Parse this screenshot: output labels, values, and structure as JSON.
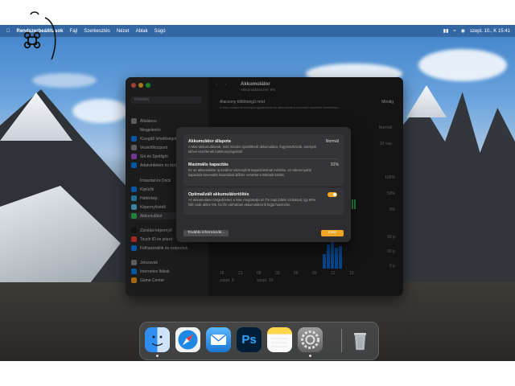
{
  "menubar": {
    "app_name": "Rendszerbeállítások",
    "menus": [
      "Fájl",
      "Szerkesztés",
      "Nézet",
      "Ablak",
      "Súgó"
    ],
    "clock": "szept. 10., K  15:41"
  },
  "settings_window": {
    "search_placeholder": "Keresés",
    "sidebar_items": [
      {
        "label": "Általános",
        "color": "#8e8e93"
      },
      {
        "label": "Megjelenés",
        "color": "#2c2c2e"
      },
      {
        "label": "Kisegítő lehetőségek",
        "color": "#0a84ff"
      },
      {
        "label": "Vezérlőközpont",
        "color": "#8e8e93"
      },
      {
        "label": "Siri és Spotlight",
        "color": "#af52de"
      },
      {
        "label": "Adatvédelem és biztonság",
        "color": "#0a84ff"
      },
      {
        "label": "Íróasztal és Dock",
        "color": "#2c2c2e"
      },
      {
        "label": "Kijelzők",
        "color": "#0a84ff"
      },
      {
        "label": "Háttérkép",
        "color": "#32ade6"
      },
      {
        "label": "Képernyővédő",
        "color": "#5ac8fa"
      },
      {
        "label": "Akkumulátor",
        "color": "#34c759"
      },
      {
        "label": "Zárolási képernyő",
        "color": "#1c1c1e"
      },
      {
        "label": "Touch ID és jelszó",
        "color": "#ff3b30"
      },
      {
        "label": "Felhasználók és csoportok",
        "color": "#0a84ff"
      },
      {
        "label": "Jelszavak",
        "color": "#8e8e93"
      },
      {
        "label": "Internetes fiókok",
        "color": "#0a84ff"
      },
      {
        "label": "Game Center",
        "color": "#ff9f0a"
      }
    ],
    "content": {
      "title": "Akkumulátor",
      "subtitle": "Akkumulátorszint: 8%",
      "low_power_label": "Alacsony töltöttségű mód",
      "low_power_value": "Mindig",
      "low_power_desc": "A Mac csökkenti energiafogyasztását az akkumulátor-üzemidő növelése érdekében.",
      "health_value": "Normál",
      "range_value": "10 nap",
      "chart_y": [
        "100%",
        "50%",
        "0%",
        "60 p",
        "30 p",
        "0 p"
      ],
      "chart_x": [
        "18",
        "21",
        "00",
        "03",
        "06",
        "09",
        "12",
        "15"
      ],
      "chart_dates": [
        "szept. 9.",
        "szept. 10."
      ]
    }
  },
  "dialog": {
    "health": {
      "title": "Akkumulátor állapota",
      "value": "Normál",
      "text": "A Mac-akkumulátorok, mint minden újratölthető akkumulátor, fogyóeszközök, amelyek idővel veszítenek hatékonyságukból."
    },
    "capacity": {
      "title": "Maximális kapacitás",
      "value": "91%",
      "text": "Ez az akkumulátor új korához viszonyított kapacitásának mértéke. Az alacsonyabb kapacitás kevesebb használati időhöz vezethet a töltések között."
    },
    "optimized": {
      "title": "Optimalizált akkumulátortöltés",
      "text": "Az akkumulátor-öregedéshez a Mac megtanulja az Ön napi töltési szokásait, így 80% fölé csak akkor tölt, ha Ön várhatóan akkumulátorról fogja használni.",
      "enabled": true
    },
    "more_info_label": "További információk...",
    "done_label": "Kész"
  },
  "dock": {
    "apps": [
      {
        "name": "Finder",
        "icon": "finder-icon"
      },
      {
        "name": "Safari",
        "icon": "safari-icon"
      },
      {
        "name": "Mail",
        "icon": "mail-icon"
      },
      {
        "name": "Photoshop",
        "icon": "photoshop-icon",
        "label": "Ps"
      },
      {
        "name": "Jegyzetek",
        "icon": "notes-icon"
      },
      {
        "name": "Rendszerbeállítások",
        "icon": "settings-icon"
      },
      {
        "name": "Kuka",
        "icon": "trash-icon"
      }
    ]
  }
}
